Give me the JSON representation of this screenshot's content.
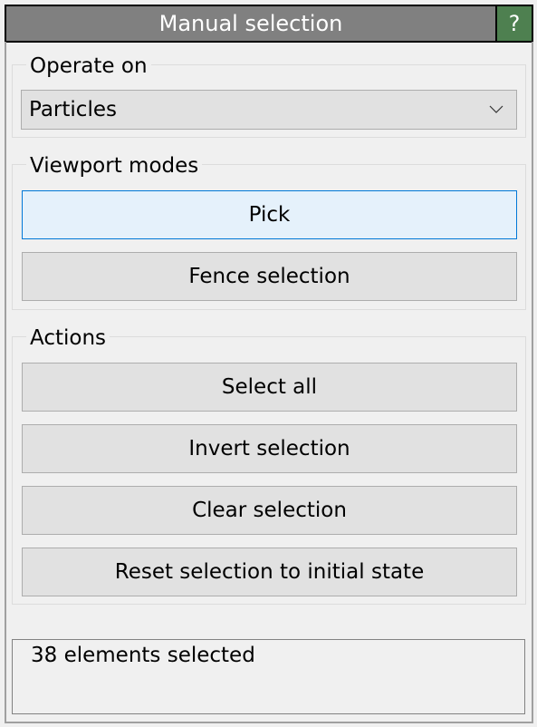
{
  "title": "Manual selection",
  "help_label": "?",
  "operate_on": {
    "label": "Operate on",
    "selected": "Particles"
  },
  "viewport_modes": {
    "label": "Viewport modes",
    "buttons": [
      {
        "label": "Pick",
        "active": true
      },
      {
        "label": "Fence selection",
        "active": false
      }
    ]
  },
  "actions": {
    "label": "Actions",
    "buttons": [
      {
        "label": "Select all"
      },
      {
        "label": "Invert selection"
      },
      {
        "label": "Clear selection"
      },
      {
        "label": "Reset selection to initial state"
      }
    ]
  },
  "status": "38 elements selected"
}
